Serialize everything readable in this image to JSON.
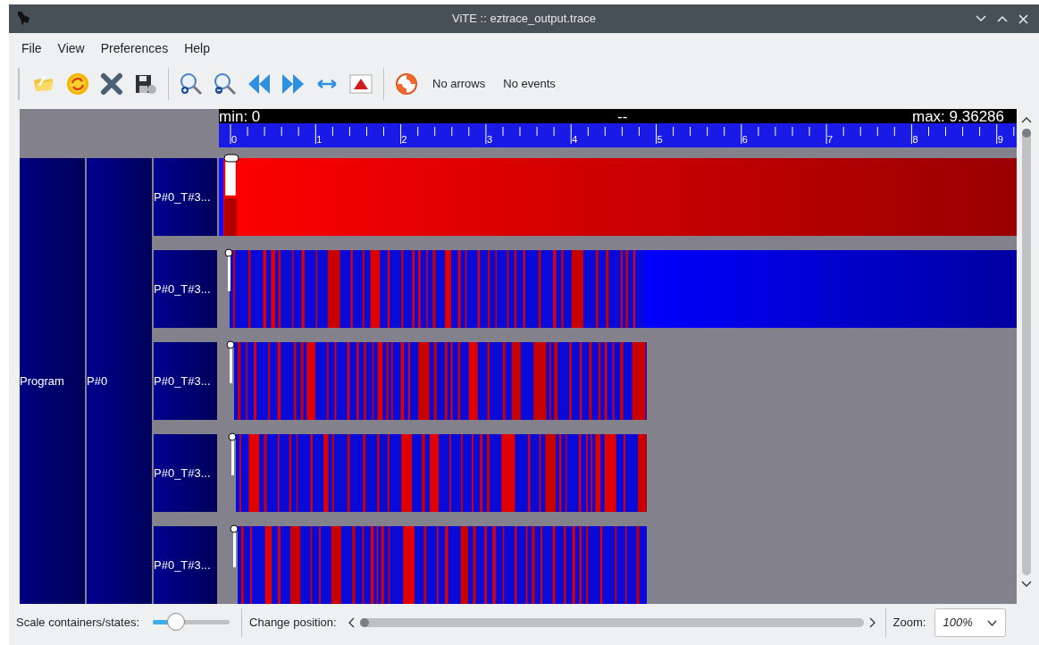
{
  "window": {
    "title": "ViTE :: eztrace_output.trace"
  },
  "menu": [
    "File",
    "View",
    "Preferences",
    "Help"
  ],
  "toolbar": {
    "buttons": [
      {
        "kind": "open"
      },
      {
        "kind": "reload"
      },
      {
        "kind": "close"
      },
      {
        "kind": "export"
      },
      {
        "kind": "separator"
      },
      {
        "kind": "zoom-in"
      },
      {
        "kind": "zoom-out"
      },
      {
        "kind": "back"
      },
      {
        "kind": "forward"
      },
      {
        "kind": "fit"
      },
      {
        "kind": "shape"
      },
      {
        "kind": "separator"
      },
      {
        "kind": "help"
      }
    ],
    "labels": [
      "No arrows",
      "No events"
    ]
  },
  "ruler": {
    "min": "min: 0",
    "center": "--",
    "max": "max: 9.36286",
    "ticks": [
      "0",
      "1",
      "2",
      "3",
      "4",
      "5",
      "6",
      "7",
      "8",
      "9"
    ]
  },
  "containers": {
    "program": "Program",
    "process": "P#0",
    "threads": [
      {
        "label": "P#0_T#3...",
        "kind": "long-state"
      },
      {
        "label": "P#0_T#3...",
        "kind": "mixed-tail"
      },
      {
        "label": "P#0_T#3...",
        "kind": "mixed"
      },
      {
        "label": "P#0_T#3...",
        "kind": "mixed"
      },
      {
        "label": "P#0_T#3...",
        "kind": "mixed"
      }
    ]
  },
  "status_bar": {
    "scale_label": "Scale containers/states:",
    "scale": {
      "level": 0.3
    },
    "position_label": "Change position:",
    "zoom_label": "Zoom:",
    "zoom_value": "100%"
  }
}
